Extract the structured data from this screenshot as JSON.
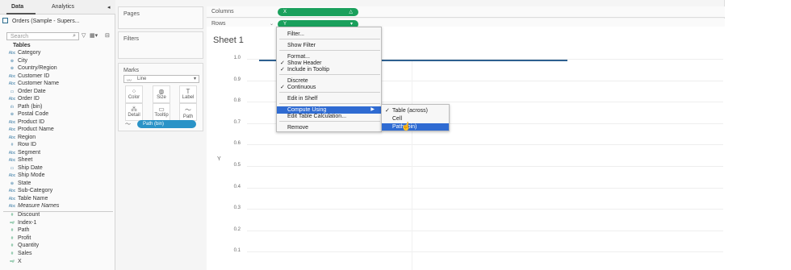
{
  "tabs": {
    "data": "Data",
    "analytics": "Analytics"
  },
  "datasource": {
    "name": "Orders (Sample - Supers..."
  },
  "search": {
    "placeholder": "Search"
  },
  "tables_label": "Tables",
  "dimensions": [
    {
      "icon": "Abc",
      "name": "Category"
    },
    {
      "icon": "⊕",
      "name": "City"
    },
    {
      "icon": "⊕",
      "name": "Country/Region"
    },
    {
      "icon": "Abc",
      "name": "Customer ID"
    },
    {
      "icon": "Abc",
      "name": "Customer Name"
    },
    {
      "icon": "▭",
      "name": "Order Date"
    },
    {
      "icon": "Abc",
      "name": "Order ID"
    },
    {
      "icon": "ılı",
      "name": "Path (bin)"
    },
    {
      "icon": "⊕",
      "name": "Postal Code"
    },
    {
      "icon": "Abc",
      "name": "Product ID"
    },
    {
      "icon": "Abc",
      "name": "Product Name"
    },
    {
      "icon": "Abc",
      "name": "Region"
    },
    {
      "icon": "#",
      "name": "Row ID"
    },
    {
      "icon": "Abc",
      "name": "Segment"
    },
    {
      "icon": "Abc",
      "name": "Sheet"
    },
    {
      "icon": "▭",
      "name": "Ship Date"
    },
    {
      "icon": "Abc",
      "name": "Ship Mode"
    },
    {
      "icon": "⊕",
      "name": "State"
    },
    {
      "icon": "Abc",
      "name": "Sub-Category"
    },
    {
      "icon": "Abc",
      "name": "Table Name"
    },
    {
      "icon": "Abc",
      "name": "Measure Names"
    }
  ],
  "measures": [
    {
      "icon": "#",
      "name": "Discount"
    },
    {
      "icon": "=#",
      "name": "Index-1"
    },
    {
      "icon": "#",
      "name": "Path"
    },
    {
      "icon": "#",
      "name": "Profit"
    },
    {
      "icon": "#",
      "name": "Quantity"
    },
    {
      "icon": "#",
      "name": "Sales"
    },
    {
      "icon": "=#",
      "name": "X"
    }
  ],
  "cards": {
    "pages": "Pages",
    "filters": "Filters",
    "marks": "Marks"
  },
  "marks": {
    "type": "Line",
    "buttons": [
      "Color",
      "Size",
      "Label",
      "Detail",
      "Tooltip",
      "Path"
    ],
    "pill": "Path (bin)"
  },
  "shelves": {
    "columns_label": "Columns",
    "rows_label": "Rows",
    "columns_pill": "X",
    "rows_pill": "Y"
  },
  "sheet": {
    "title": "Sheet 1",
    "y_axis_label": "Y",
    "ticks": [
      "1.0",
      "0.9",
      "0.8",
      "0.7",
      "0.6",
      "0.5",
      "0.4",
      "0.3",
      "0.2",
      "0.1"
    ]
  },
  "context_menu": {
    "items": [
      {
        "label": "Filter...",
        "checked": false
      },
      {
        "label": "Show Filter",
        "checked": false
      },
      {
        "label": "Format...",
        "checked": false
      },
      {
        "label": "Show Header",
        "checked": true
      },
      {
        "label": "Include in Tooltip",
        "checked": true
      },
      {
        "label": "Discrete",
        "checked": false
      },
      {
        "label": "Continuous",
        "checked": true
      },
      {
        "label": "Edit in Shelf",
        "checked": false
      },
      {
        "label": "Compute Using",
        "checked": false,
        "submenu": true
      },
      {
        "label": "Edit Table Calculation...",
        "checked": false
      },
      {
        "label": "Remove",
        "checked": false
      }
    ]
  },
  "compute_using_submenu": {
    "items": [
      {
        "label": "Table (across)",
        "checked": true
      },
      {
        "label": "Cell",
        "checked": false
      },
      {
        "label": "Path (bin)",
        "checked": false
      }
    ]
  },
  "colors": {
    "pill_green": "#1aa05c",
    "pill_blue": "#2a93c7",
    "highlight": "#2f6bd2",
    "line": "#2d5f8f"
  }
}
